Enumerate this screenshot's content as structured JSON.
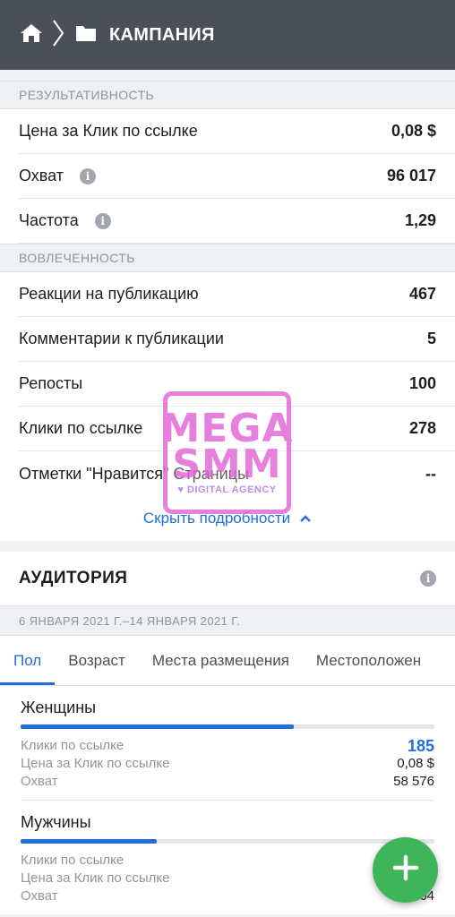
{
  "header": {
    "title": "КАМПАНИЯ",
    "home_icon": "home-icon",
    "folder_icon": "folder-icon"
  },
  "performance": {
    "section_title": "РЕЗУЛЬТАТИВНОСТЬ",
    "rows": [
      {
        "label": "Цена за Клик по ссылке",
        "value": "0,08 $",
        "info": false
      },
      {
        "label": "Охват",
        "value": "96 017",
        "info": true
      },
      {
        "label": "Частота",
        "value": "1,29",
        "info": true
      }
    ]
  },
  "engagement": {
    "section_title": "ВОВЛЕЧЕННОСТЬ",
    "rows": [
      {
        "label": "Реакции на публикацию",
        "value": "467"
      },
      {
        "label": "Комментарии к публикации",
        "value": "5"
      },
      {
        "label": "Репосты",
        "value": "100"
      },
      {
        "label": "Клики по ссылке",
        "value": "278"
      },
      {
        "label": "Отметки \"Нравится\" Страницы",
        "value": "--"
      }
    ],
    "hide_details": "Скрыть подробности"
  },
  "audience": {
    "title": "АУДИТОРИЯ",
    "date_range": "6 ЯНВАРЯ 2021 Г.–14 ЯНВАРЯ 2021 Г.",
    "tabs": [
      "Пол",
      "Возраст",
      "Места размещения",
      "Местоположен"
    ],
    "active_tab": 0,
    "groups": [
      {
        "name": "Женщины",
        "share": 0.66,
        "metrics": [
          {
            "label": "Клики по ссылке",
            "value": "185",
            "accent": true
          },
          {
            "label": "Цена за Клик по ссылке",
            "value": "0,08 $",
            "accent": false
          },
          {
            "label": "Охват",
            "value": "58 576",
            "accent": false
          }
        ]
      },
      {
        "name": "Мужчины",
        "share": 0.33,
        "metrics": [
          {
            "label": "Клики по ссылке",
            "value": "",
            "accent": true
          },
          {
            "label": "Цена за Клик по ссылке",
            "value": "",
            "accent": false
          },
          {
            "label": "Охват",
            "value": "…64",
            "accent": false
          }
        ]
      }
    ]
  },
  "watermark": {
    "line1": "MEGA",
    "line2": "SMM",
    "line3": "DIGITAL AGENCY"
  },
  "fab": {
    "icon": "plus-icon"
  },
  "colors": {
    "topbar": "#4b4f56",
    "accent": "#216fdb",
    "fab": "#3fb55a",
    "watermark": "#e36bd8"
  }
}
